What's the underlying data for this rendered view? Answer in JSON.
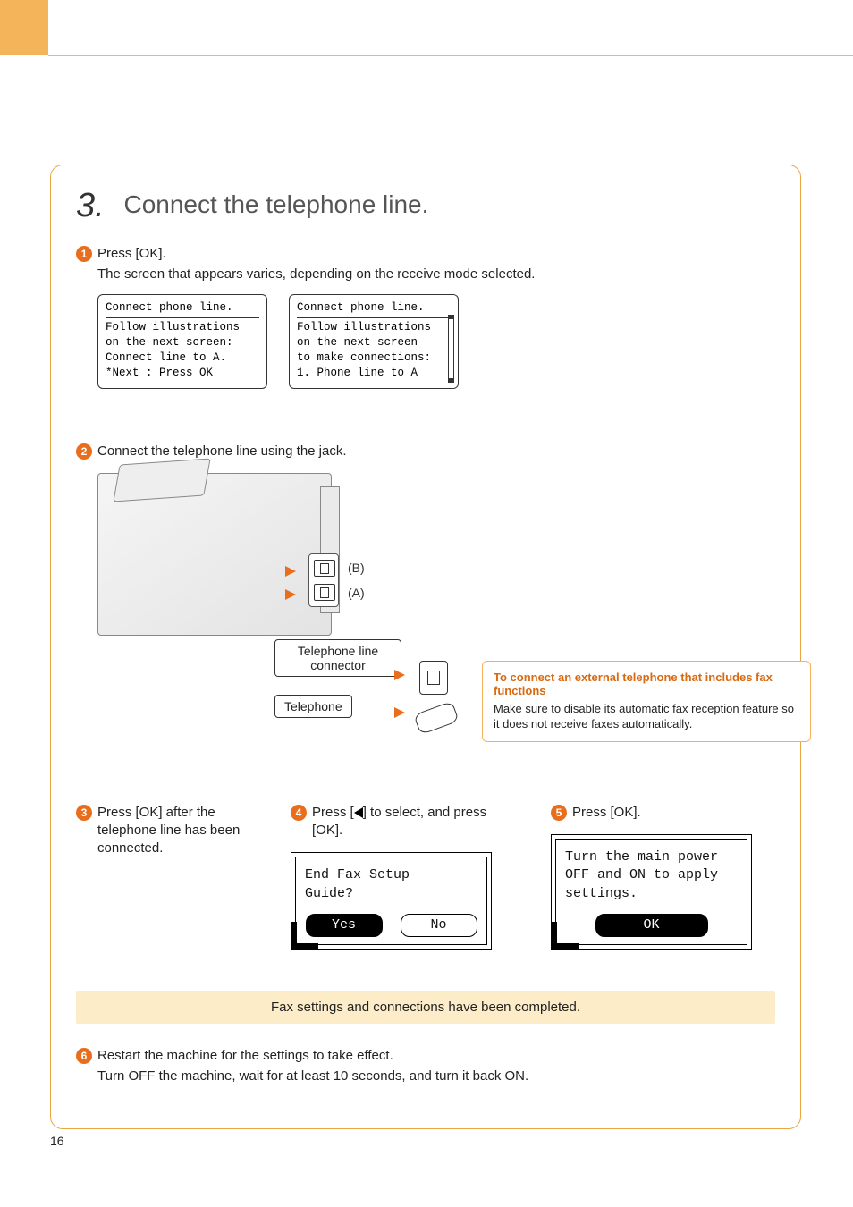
{
  "section": {
    "number": "3.",
    "title": "Connect the telephone line."
  },
  "step1": {
    "text": "Press [OK].",
    "note": "The screen that appears varies, depending on the receive mode selected.",
    "screen_a": {
      "header": "Connect phone line.",
      "l1": " Follow illustrations",
      "l2": " on the next screen:",
      "l3": " Connect line to A.",
      "l4": " *Next : Press OK"
    },
    "screen_b": {
      "header": "Connect phone line.",
      "l1": " Follow illustrations",
      "l2": " on the next screen",
      "l3": " to make connections:",
      "l4": " 1. Phone line to A"
    }
  },
  "step2": {
    "text": "Connect the telephone line using the jack.",
    "labels": {
      "b": "(B)",
      "a": "(A)",
      "connector": "Telephone line connector",
      "telephone": "Telephone"
    },
    "tip": {
      "title": "To connect an external telephone that includes fax functions",
      "body": "Make sure to disable its automatic fax reception feature so it does not receive faxes automatically."
    }
  },
  "step3": {
    "text": "Press [OK] after the telephone line has been connected."
  },
  "step4": {
    "pre_text": "Press [",
    "post_text": "] to select, and press [OK].",
    "screen": {
      "l1": "End Fax Setup",
      "l2": "Guide?",
      "yes": "Yes",
      "no": "No"
    }
  },
  "step5": {
    "text": "Press [OK].",
    "screen": {
      "l1": "Turn the main power",
      "l2": "OFF and ON to apply",
      "l3": "settings.",
      "ok": "OK"
    }
  },
  "done_bar": "Fax settings and connections have been completed.",
  "step6": {
    "text": "Restart the machine for the settings to take effect.",
    "note": "Turn OFF the machine, wait for at least 10 seconds, and turn it back ON."
  },
  "page_number": "16"
}
